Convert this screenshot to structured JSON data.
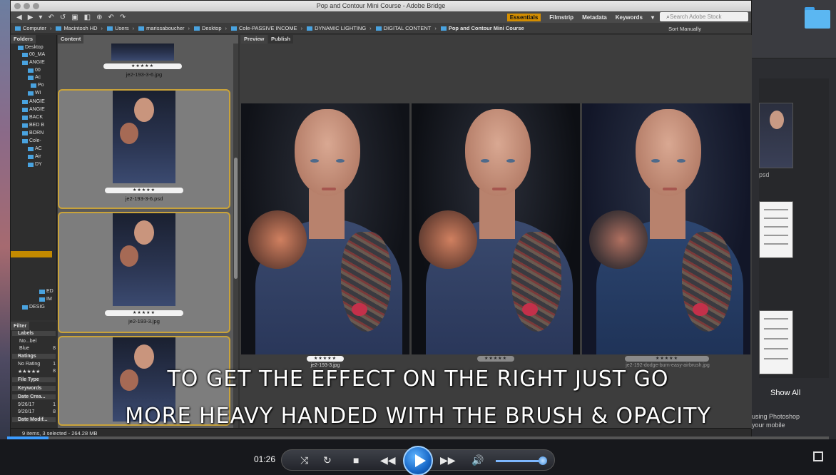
{
  "window": {
    "title": "Pop and Contour Mini Course - Adobe Bridge"
  },
  "workspace": [
    "Essentials",
    "Filmstrip",
    "Metadata",
    "Keywords"
  ],
  "search": {
    "placeholder": "Search Adobe Stock"
  },
  "breadcrumb": [
    "Computer",
    "Macintosh HD",
    "Users",
    "marissaboucher",
    "Desktop",
    "Cole-PASSIVE INCOME",
    "DYNAMIC LIGHTING",
    "DIGITAL CONTENT",
    "Pop and Contour Mini Course"
  ],
  "sort": {
    "label": "Sort Manually"
  },
  "panels": {
    "folders_tab": "Folders",
    "content_tab": "Content",
    "preview_tab": "Preview",
    "publish_tab": "Publish",
    "filter_tab": "Filter"
  },
  "folder_tree": [
    "Desktop",
    "00_MA",
    "ANGIE",
    "00",
    "Ac",
    "Po",
    "WI",
    "ANGIE",
    "ANGIE",
    "BACK",
    "BED B",
    "BORN",
    "Cole-",
    "AC",
    "Air",
    "DY",
    "ED",
    "IM",
    "DESIG"
  ],
  "filter": {
    "labels_head": "Labels",
    "label_items": [
      {
        "name": "No...bel",
        "count": ""
      },
      {
        "name": "Blue",
        "count": "8"
      }
    ],
    "ratings_head": "Ratings",
    "rating_items": [
      {
        "name": "No Rating",
        "count": "1"
      },
      {
        "name": "★★★★★",
        "count": "8"
      }
    ],
    "file_type_head": "File Type",
    "keywords_head": "Keywords",
    "date_head": "Date Crea...",
    "date_items": [
      {
        "name": "9/26/17",
        "count": "1"
      },
      {
        "name": "9/20/17",
        "count": "8"
      }
    ],
    "date_mod_head": "Date Modif..."
  },
  "content_items": [
    {
      "name": "je2-193-3-6.jpg",
      "rating": "★★★★★"
    },
    {
      "name": "je2-193-3-6.psd",
      "rating": "★★★★★"
    },
    {
      "name": "je2-193-3.jpg",
      "rating": "★★★★★"
    }
  ],
  "preview_items": [
    {
      "name": "je2-193-3.jpg",
      "rating": "★★★★★"
    },
    {
      "name": "",
      "rating": "★★★★★"
    },
    {
      "name": "je2-192-dodge-burn-easy-airbrush.jpg",
      "rating": "★★★★★"
    }
  ],
  "status": {
    "text": "9 items, 3 selected - 264.28 MB"
  },
  "background_app": {
    "label1": "psd",
    "show_all": "Show All",
    "promo_line1": "using Photoshop",
    "promo_line2": "your mobile"
  },
  "subtitles": {
    "line1": "TO GET THE EFFECT ON THE RIGHT JUST GO",
    "line2": "MORE HEAVY HANDED WITH THE BRUSH & OPACITY"
  },
  "player": {
    "time": "01:26",
    "progress": 0.05,
    "volume": 0.9
  },
  "colors": {
    "accent": "#d48e00",
    "selection_border": "#c9a33a",
    "player_blue": "#1868c8"
  }
}
